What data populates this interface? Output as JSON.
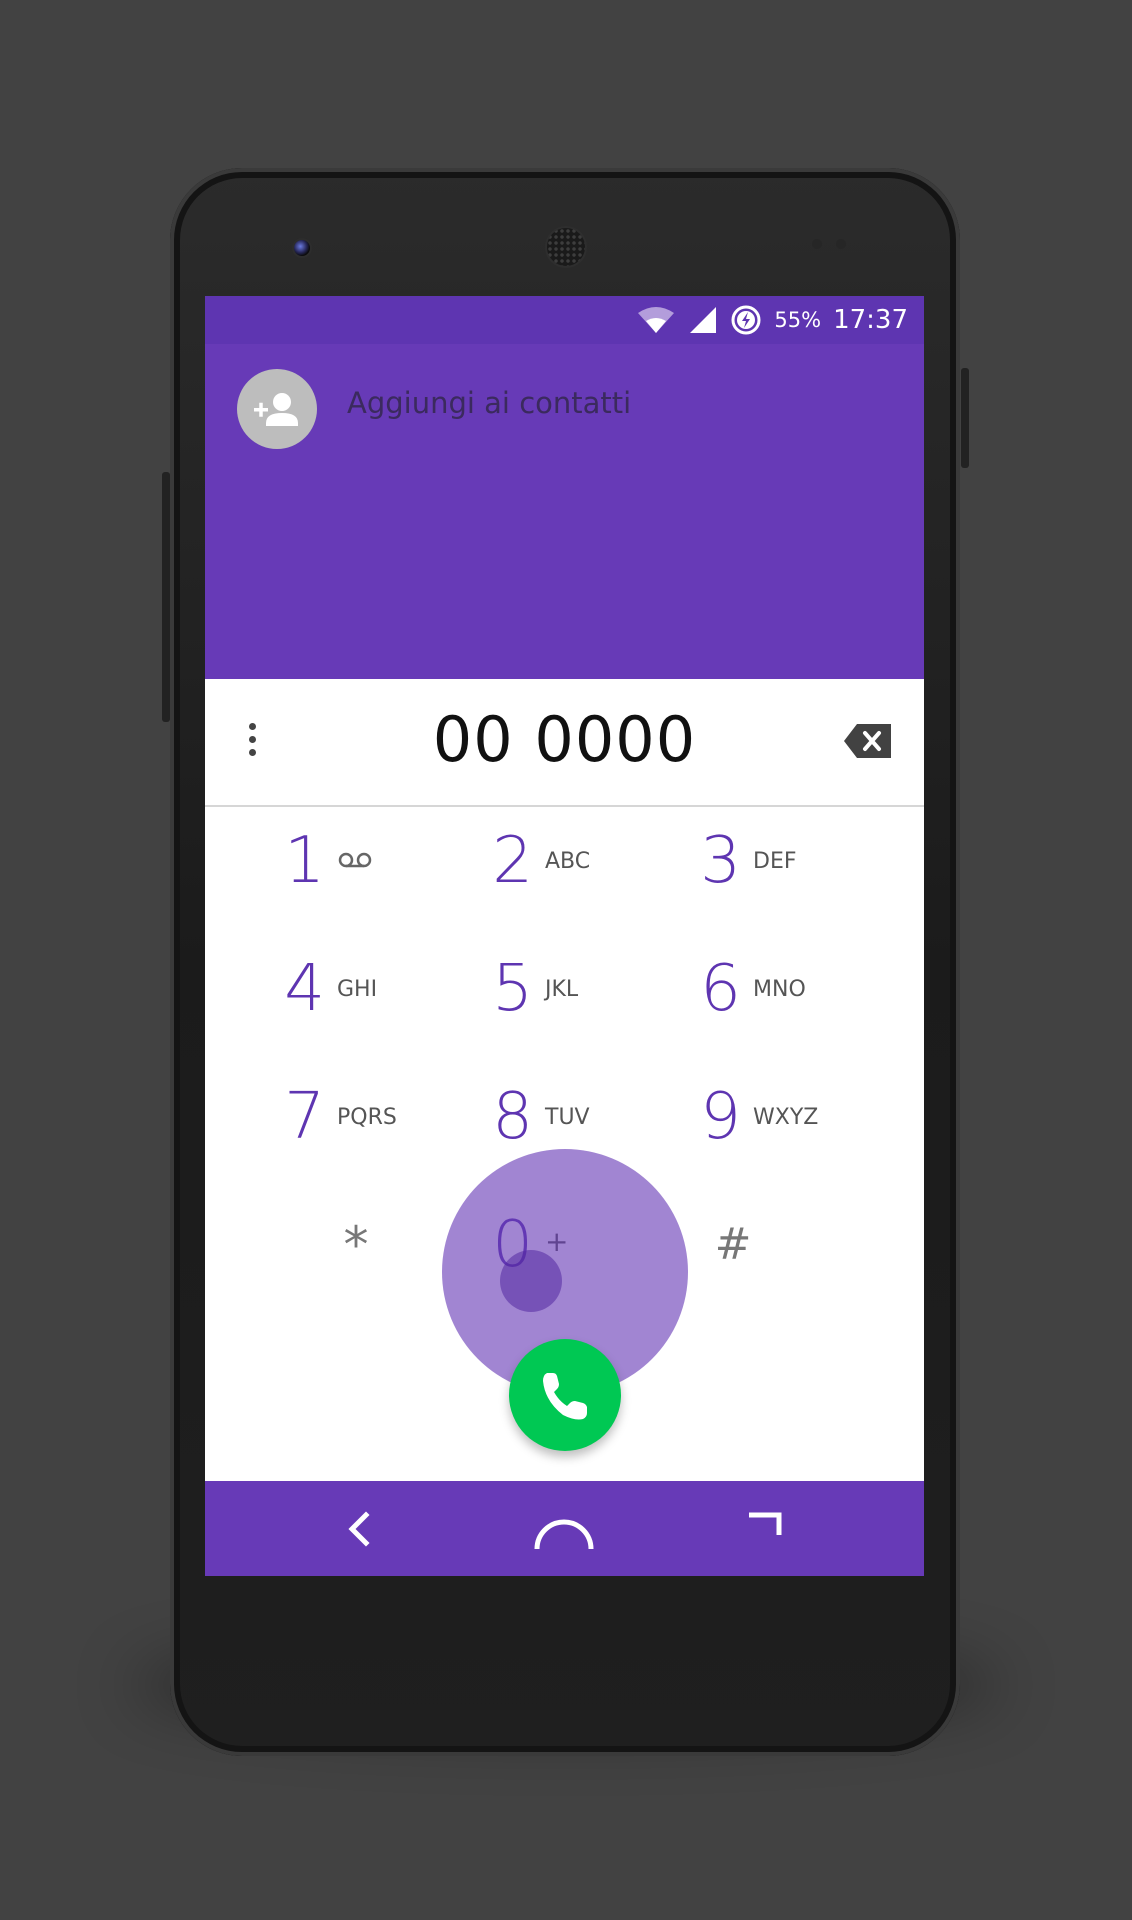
{
  "status_bar": {
    "battery_percent": "55%",
    "time": "17:37",
    "icons": [
      "wifi-icon",
      "cell-signal-icon",
      "battery-saver-icon"
    ]
  },
  "header": {
    "add_contact_label": "Aggiungi ai contatti",
    "avatar_icon": "add-person-icon"
  },
  "dialer": {
    "entered_number": "00 0000",
    "overflow_icon": "more-vert-icon",
    "backspace_icon": "backspace-icon"
  },
  "keypad": {
    "keys": [
      {
        "digit": "1",
        "letters": "",
        "extra_icon": "voicemail-icon"
      },
      {
        "digit": "2",
        "letters": "ABC"
      },
      {
        "digit": "3",
        "letters": "DEF"
      },
      {
        "digit": "4",
        "letters": "GHI"
      },
      {
        "digit": "5",
        "letters": "JKL"
      },
      {
        "digit": "6",
        "letters": "MNO"
      },
      {
        "digit": "7",
        "letters": "PQRS"
      },
      {
        "digit": "8",
        "letters": "TUV"
      },
      {
        "digit": "9",
        "letters": "WXYZ"
      },
      {
        "digit": "*",
        "letters": ""
      },
      {
        "digit": "0",
        "letters": "+"
      },
      {
        "digit": "#",
        "letters": ""
      }
    ]
  },
  "call_button": {
    "icon": "phone-icon"
  },
  "nav_bar": {
    "buttons": [
      "back-icon",
      "home-icon",
      "recents-icon"
    ]
  },
  "colors": {
    "primary": "#673ab7",
    "primary_dark": "#5e35b1",
    "call_green": "#00c853",
    "background": "#424242"
  }
}
